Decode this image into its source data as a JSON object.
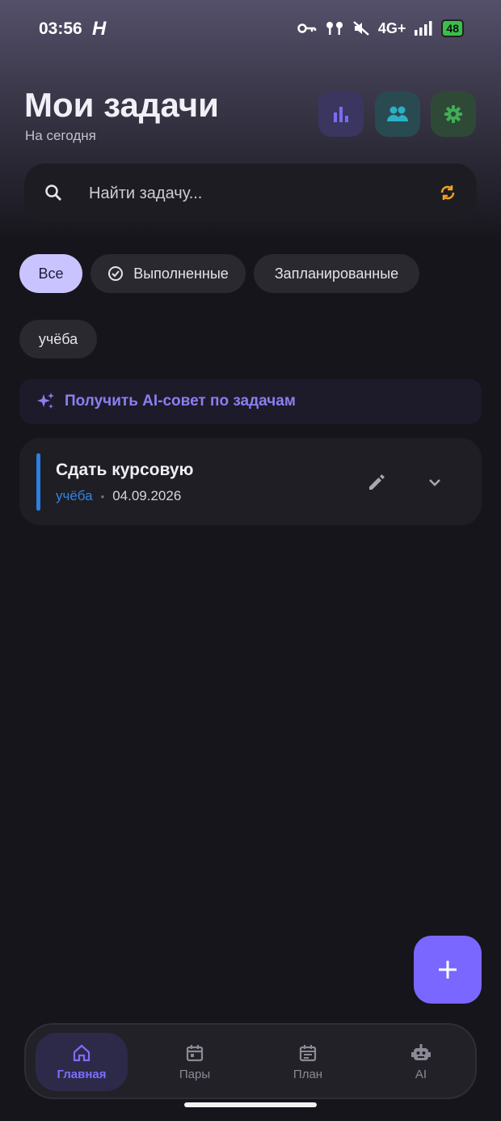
{
  "status_bar": {
    "time": "03:56",
    "logo": "H",
    "network": "4G+",
    "battery": "48"
  },
  "header": {
    "title": "Мои задачи",
    "subtitle": "На сегодня",
    "buttons": [
      {
        "icon": "bar-chart-icon"
      },
      {
        "icon": "group-icon"
      },
      {
        "icon": "gear-icon"
      }
    ]
  },
  "search": {
    "placeholder": "Найти задачу..."
  },
  "filters": {
    "all": "Все",
    "completed": "Выполненные",
    "planned": "Запланированные",
    "study": "учёба"
  },
  "ai_tip": {
    "label": "Получить AI-совет по задачам"
  },
  "tasks": [
    {
      "title": "Сдать курсовую",
      "tag": "учёба",
      "date": "04.09.2026"
    }
  ],
  "nav": {
    "home": "Главная",
    "pairs": "Пары",
    "plan": "План",
    "ai": "AI"
  },
  "colors": {
    "accent": "#7a67ff",
    "chip_active": "#c9c4ff",
    "task_bar": "#2c7fe0",
    "sync": "#f0a020"
  }
}
